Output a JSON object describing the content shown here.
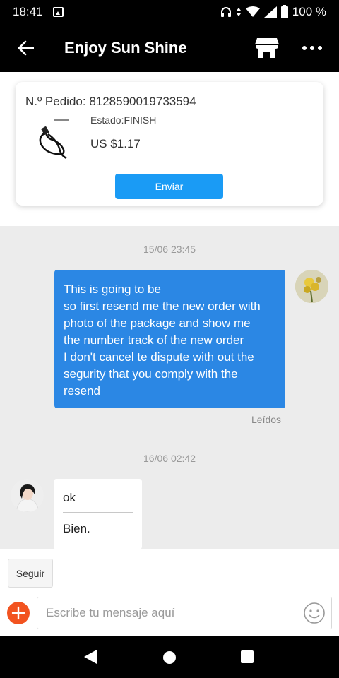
{
  "status_bar": {
    "time": "18:41",
    "battery": "100 %",
    "icons": [
      "gallery-icon",
      "headphones-icon",
      "data-arrows-icon",
      "wifi-icon",
      "signal-icon",
      "battery-icon"
    ]
  },
  "header": {
    "title": "Enjoy Sun Shine",
    "icons": [
      "back-arrow-icon",
      "store-icon",
      "more-dots-icon"
    ]
  },
  "order_card": {
    "order_number": "N.º Pedido: 8128590019733594",
    "status": "Estado:FINISH",
    "price": "US $1.17",
    "send_label": "Enviar"
  },
  "messages": [
    {
      "timestamp": "15/06 23:45",
      "sender": "me",
      "lines": [
        "This is going to be",
        "so first resend me the new order with",
        "photo of the package and show me",
        "the number track of the new order",
        "I don't cancel te dispute with out the",
        "segurity that you comply with the",
        "resend"
      ],
      "read_status": "Leídos"
    },
    {
      "timestamp": "16/06 02:42",
      "sender": "seller",
      "original": "ok",
      "translation": "Bien."
    }
  ],
  "follow_label": "Seguir",
  "composer": {
    "placeholder": "Escribe tu mensaje aquí",
    "value": ""
  },
  "colors": {
    "send_button": "#1a9bf5",
    "my_bubble": "#2b87e4",
    "add_button": "#f25320",
    "chat_background": "#ececec"
  }
}
